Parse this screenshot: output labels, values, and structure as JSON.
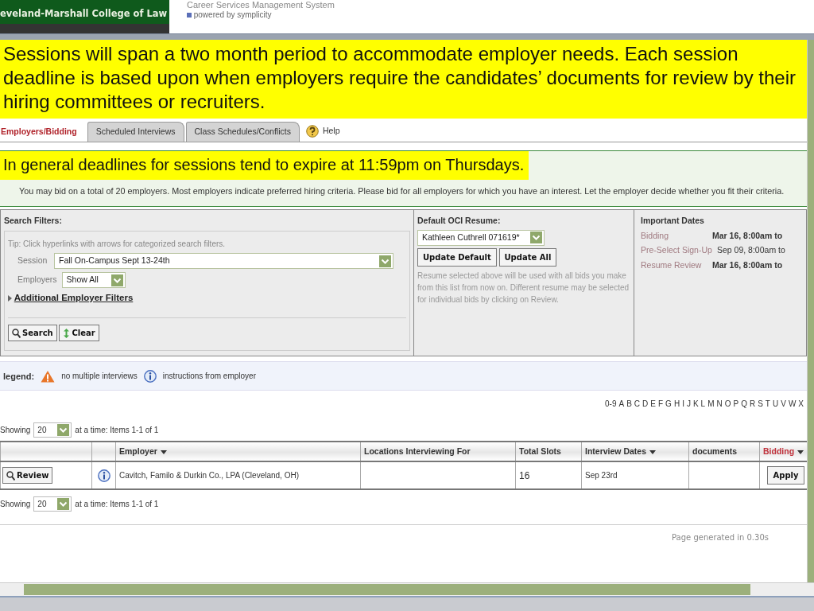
{
  "header": {
    "college": "eveland-Marshall College of Law",
    "system_title": "Career Services Management System",
    "powered_by": "powered by symplicity"
  },
  "callout_top": "Sessions will span a two month period to accommodate employer needs. Each session deadline is based upon when employers require the candidates’ documents for review by their hiring committees or recruiters.",
  "tabs": [
    {
      "label": "Employers/Bidding",
      "selected": true
    },
    {
      "label": "Scheduled Interviews",
      "selected": false
    },
    {
      "label": "Class Schedules/Conflicts",
      "selected": false
    }
  ],
  "help": "Help",
  "callout_deadline": "In general deadlines for sessions tend to expire at 11:59pm on Thursdays.",
  "intro": "You may bid on a total of 20 employers. Most employers indicate preferred hiring criteria. Please bid for all employers for which you have an interest. Let the employer decide whether you fit their criteria.",
  "search_filters": {
    "title": "Search Filters:",
    "tip": "Tip: Click hyperlinks with arrows for categorized search filters.",
    "fields": [
      {
        "label": "Session",
        "value": "Fall On-Campus Sept 13-24th"
      },
      {
        "label": "Employers",
        "value": "Show All"
      }
    ],
    "more_link": "Additional Employer Filters",
    "buttons": [
      {
        "kind": "search",
        "label": "Search"
      },
      {
        "kind": "clear",
        "label": "Clear"
      }
    ]
  },
  "resume": {
    "title": "Default OCI Resume:",
    "value": "Kathleen Cuthrell 071619*",
    "buttons": [
      "Update Default",
      "Update All"
    ],
    "note": "Resume selected above will be used with all bids you make from this list from now on. Different resume may be selected for individual bids by clicking on Review."
  },
  "important_dates": {
    "title": "Important Dates",
    "rows": [
      {
        "label": "Bidding",
        "value": "Mar 16, 8:00am to",
        "emphasis": true
      },
      {
        "label": "Pre-Select Sign-Up",
        "value": "Sep 09, 8:00am to",
        "emphasis": false
      },
      {
        "label": "Resume Review",
        "value": "Mar 16, 8:00am to",
        "emphasis": true
      }
    ]
  },
  "legend": {
    "title": "legend:",
    "items": [
      {
        "kind": "warning",
        "text": "no multiple interviews"
      },
      {
        "kind": "info",
        "text": "instructions from employer"
      }
    ]
  },
  "alphabet": [
    "0-9",
    "A",
    "B",
    "C",
    "D",
    "E",
    "F",
    "G",
    "H",
    "I",
    "J",
    "K",
    "L",
    "M",
    "N",
    "O",
    "P",
    "Q",
    "R",
    "S",
    "T",
    "U",
    "V",
    "W",
    "X"
  ],
  "pager_top": {
    "label": "Showing",
    "per_page": "20",
    "summary": "at a time: Items 1-1 of 1"
  },
  "table": {
    "columns": [
      {
        "label": "Employer",
        "sortable": true,
        "active": false
      },
      {
        "label": "Locations Interviewing For",
        "sortable": false,
        "active": false
      },
      {
        "label": "Total Slots",
        "sortable": false,
        "active": false
      },
      {
        "label": "Interview Dates",
        "sortable": true,
        "active": false
      },
      {
        "label": "documents",
        "sortable": false,
        "active": false
      },
      {
        "label": "Bidding",
        "sortable": true,
        "active": true
      }
    ],
    "rows": [
      {
        "review": "Review",
        "info": true,
        "employer": "Cavitch, Familo & Durkin Co., LPA (Cleveland, OH)",
        "total_slots": "16",
        "interview_dates": "Sep 23rd",
        "bid": "Apply"
      }
    ]
  },
  "pager_bottom": {
    "label": "Showing",
    "per_page": "20",
    "summary": "at a time: Items 1-1 of 1"
  },
  "footer": "Page generated in 0.30s"
}
